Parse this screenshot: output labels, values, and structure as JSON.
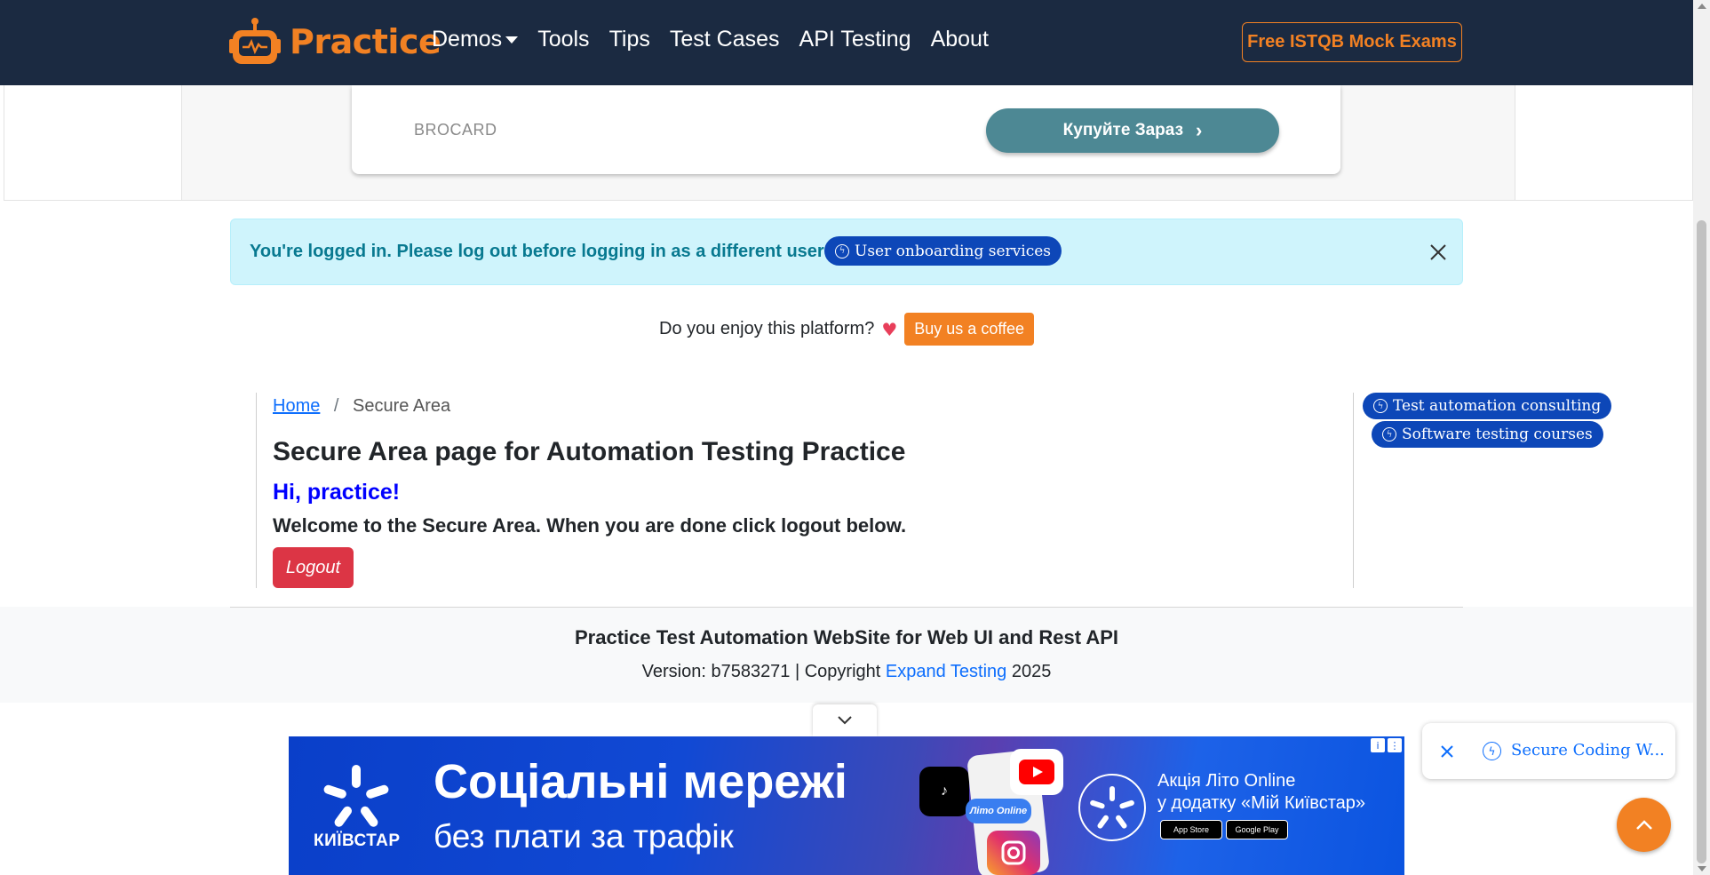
{
  "nav": {
    "brand": "Practice",
    "links": [
      "Demos",
      "Tools",
      "Tips",
      "Test Cases",
      "API Testing",
      "About"
    ],
    "cta": "Free ISTQB Mock Exams"
  },
  "top_ad": {
    "brand": "BROCARD",
    "button": "Купуйте Зараз"
  },
  "alert": {
    "message": "You're logged in. Please log out before logging in as a different user",
    "pill": "User onboarding services"
  },
  "coffee": {
    "question": "Do you enjoy this platform?",
    "button": "Buy us a coffee"
  },
  "breadcrumb": {
    "home": "Home",
    "separator": "/",
    "current": "Secure Area"
  },
  "main": {
    "title": "Secure Area page for Automation Testing Practice",
    "greeting": "Hi, practice!",
    "welcome": "Welcome to the Secure Area. When you are done click logout below.",
    "logout": "Logout"
  },
  "sidebar": {
    "pills": [
      "Test automation consulting",
      "Software testing courses"
    ]
  },
  "footer": {
    "title": "Practice Test Automation WebSite for Web UI and Rest API",
    "version_prefix": "Version: b7583271 | Copyright",
    "company": "Expand Testing",
    "year": "2025"
  },
  "bottom_ad": {
    "brand": "КИЇВСТАР",
    "headline": "Соціальні мережі",
    "subline": "без плати за трафік",
    "promo_line1": "Акція Літо Online",
    "promo_line2": "у додатку «Мій Київстар»",
    "app_store": "App Store",
    "google_play": "Google Play",
    "phone_label": "Літо Online"
  },
  "toast": {
    "text": "Secure Coding W..."
  },
  "colors": {
    "navbar": "#1b2a41",
    "brand_orange": "#f28123",
    "alert_bg": "#cff4fc",
    "pill_blue": "#0d47b8",
    "logout_red": "#dc3545"
  }
}
